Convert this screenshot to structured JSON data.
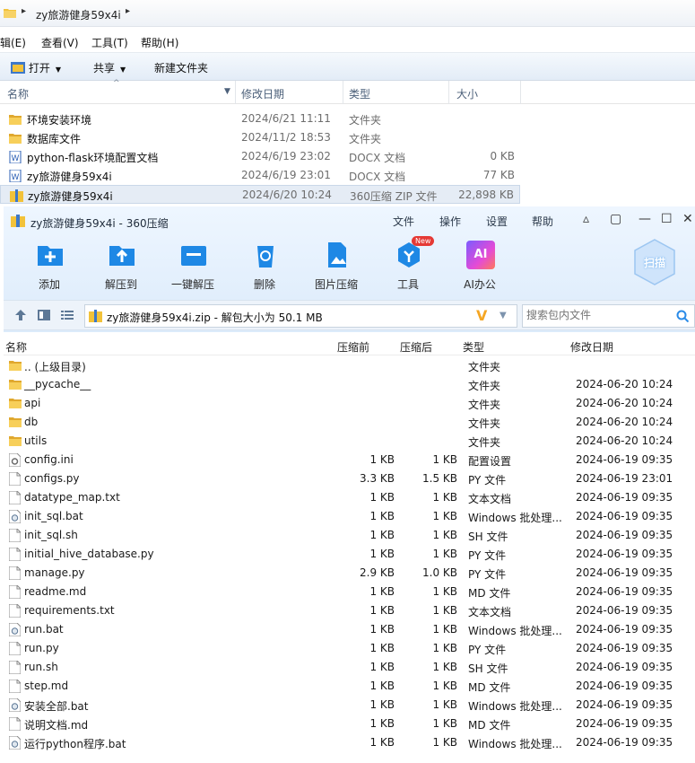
{
  "explorer": {
    "breadcrumb": "zy旅游健身59x4i",
    "menu": [
      "辑(E)",
      "查看(V)",
      "工具(T)",
      "帮助(H)"
    ],
    "toolbar": {
      "open": "打开",
      "share": "共享",
      "new_folder": "新建文件夹"
    },
    "columns": {
      "name": "名称",
      "date": "修改日期",
      "type": "类型",
      "size": "大小"
    },
    "rows": [
      {
        "name": "环境安装环境",
        "date": "2024/6/21 11:11",
        "type": "文件夹",
        "size": "",
        "icon": "folder-icon"
      },
      {
        "name": "数据库文件",
        "date": "2024/11/2 18:53",
        "type": "文件夹",
        "size": "",
        "icon": "folder-icon"
      },
      {
        "name": "python-flask环境配置文档",
        "date": "2024/6/19 23:02",
        "type": "DOCX 文档",
        "size": "0 KB",
        "icon": "docx-icon"
      },
      {
        "name": "zy旅游健身59x4i",
        "date": "2024/6/19 23:01",
        "type": "DOCX 文档",
        "size": "77 KB",
        "icon": "docx-icon"
      },
      {
        "name": "zy旅游健身59x4i",
        "date": "2024/6/20 10:24",
        "type": "360压缩 ZIP 文件",
        "size": "22,898 KB",
        "icon": "zip-icon",
        "selected": true
      }
    ]
  },
  "zipwin": {
    "title": "zy旅游健身59x4i - 360压缩",
    "menu": {
      "file": "文件",
      "ops": "操作",
      "settings": "设置",
      "help": "帮助"
    },
    "tools": {
      "add": "添加",
      "extract_to": "解压到",
      "one_click": "一键解压",
      "delete": "删除",
      "image_compress": "图片压缩",
      "tools": "工具",
      "ai_office": "AI办公",
      "new_badge": "New",
      "ai_glyph": "AI",
      "scan": "扫描"
    },
    "path": "zy旅游健身59x4i.zip - 解包大小为 50.1 MB",
    "search_placeholder": "搜索包内文件",
    "columns": {
      "name": "名称",
      "before": "压缩前",
      "after": "压缩后",
      "type": "类型",
      "date": "修改日期"
    },
    "rows": [
      {
        "name": ".. (上级目录)",
        "before": "",
        "after": "",
        "type": "文件夹",
        "date": "",
        "icon": "folder-icon"
      },
      {
        "name": "__pycache__",
        "before": "",
        "after": "",
        "type": "文件夹",
        "date": "2024-06-20 10:24",
        "icon": "folder-icon"
      },
      {
        "name": "api",
        "before": "",
        "after": "",
        "type": "文件夹",
        "date": "2024-06-20 10:24",
        "icon": "folder-icon"
      },
      {
        "name": "db",
        "before": "",
        "after": "",
        "type": "文件夹",
        "date": "2024-06-20 10:24",
        "icon": "folder-icon"
      },
      {
        "name": "utils",
        "before": "",
        "after": "",
        "type": "文件夹",
        "date": "2024-06-20 10:24",
        "icon": "folder-icon"
      },
      {
        "name": "config.ini",
        "before": "1 KB",
        "after": "1 KB",
        "type": "配置设置",
        "date": "2024-06-19 09:35",
        "icon": "config-file-icon"
      },
      {
        "name": "configs.py",
        "before": "3.3 KB",
        "after": "1.5 KB",
        "type": "PY 文件",
        "date": "2024-06-19 23:01",
        "icon": "file-icon"
      },
      {
        "name": "datatype_map.txt",
        "before": "1 KB",
        "after": "1 KB",
        "type": "文本文档",
        "date": "2024-06-19 09:35",
        "icon": "file-icon"
      },
      {
        "name": "init_sql.bat",
        "before": "1 KB",
        "after": "1 KB",
        "type": "Windows 批处理...",
        "date": "2024-06-19 09:35",
        "icon": "batch-file-icon"
      },
      {
        "name": "init_sql.sh",
        "before": "1 KB",
        "after": "1 KB",
        "type": "SH 文件",
        "date": "2024-06-19 09:35",
        "icon": "file-icon"
      },
      {
        "name": "initial_hive_database.py",
        "before": "1 KB",
        "after": "1 KB",
        "type": "PY 文件",
        "date": "2024-06-19 09:35",
        "icon": "file-icon"
      },
      {
        "name": "manage.py",
        "before": "2.9 KB",
        "after": "1.0 KB",
        "type": "PY 文件",
        "date": "2024-06-19 09:35",
        "icon": "file-icon"
      },
      {
        "name": "readme.md",
        "before": "1 KB",
        "after": "1 KB",
        "type": "MD 文件",
        "date": "2024-06-19 09:35",
        "icon": "file-icon"
      },
      {
        "name": "requirements.txt",
        "before": "1 KB",
        "after": "1 KB",
        "type": "文本文档",
        "date": "2024-06-19 09:35",
        "icon": "file-icon"
      },
      {
        "name": "run.bat",
        "before": "1 KB",
        "after": "1 KB",
        "type": "Windows 批处理...",
        "date": "2024-06-19 09:35",
        "icon": "batch-file-icon"
      },
      {
        "name": "run.py",
        "before": "1 KB",
        "after": "1 KB",
        "type": "PY 文件",
        "date": "2024-06-19 09:35",
        "icon": "file-icon"
      },
      {
        "name": "run.sh",
        "before": "1 KB",
        "after": "1 KB",
        "type": "SH 文件",
        "date": "2024-06-19 09:35",
        "icon": "file-icon"
      },
      {
        "name": "step.md",
        "before": "1 KB",
        "after": "1 KB",
        "type": "MD 文件",
        "date": "2024-06-19 09:35",
        "icon": "file-icon"
      },
      {
        "name": "安装全部.bat",
        "before": "1 KB",
        "after": "1 KB",
        "type": "Windows 批处理...",
        "date": "2024-06-19 09:35",
        "icon": "batch-file-icon"
      },
      {
        "name": "说明文档.md",
        "before": "1 KB",
        "after": "1 KB",
        "type": "MD 文件",
        "date": "2024-06-19 09:35",
        "icon": "file-icon"
      },
      {
        "name": "运行python程序.bat",
        "before": "1 KB",
        "after": "1 KB",
        "type": "Windows 批处理...",
        "date": "2024-06-19 09:35",
        "icon": "batch-file-icon"
      }
    ]
  },
  "colors": {
    "accent": "#2a8be8",
    "folder": "#f2c23a",
    "selection": "#e5ecf5",
    "new_badge": "#e53935"
  }
}
